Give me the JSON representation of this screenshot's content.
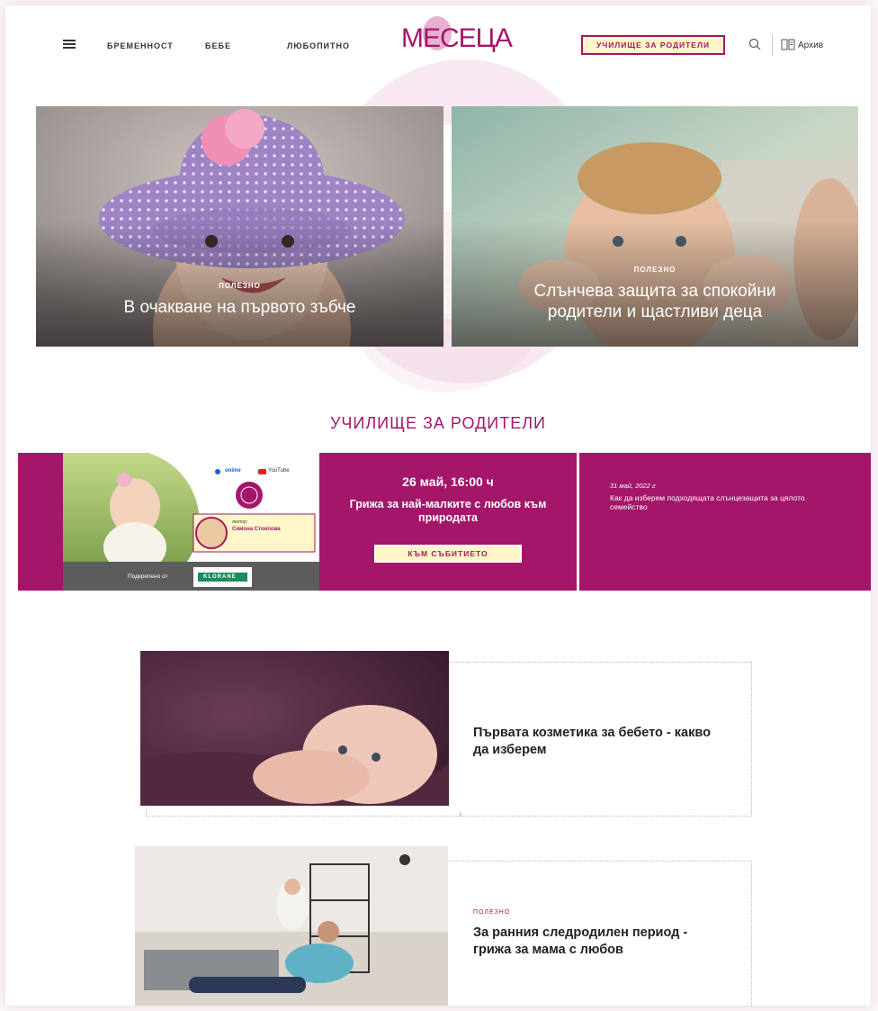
{
  "header": {
    "nav": [
      "БРЕМЕННОСТ",
      "БЕБЕ",
      "ЛЮБОПИТНО"
    ],
    "logo": "МЕСЕЦА",
    "school_button": "УЧИЛИЩЕ ЗА РОДИТЕЛИ",
    "archive": "Архив"
  },
  "hero": [
    {
      "tag": "ПОЛЕЗНО",
      "title": "В очакване на първото зъбче"
    },
    {
      "tag": "ПОЛЕЗНО",
      "title": "Слънчева защита за спокойни родители и щастливи деца"
    }
  ],
  "school": {
    "title": "УЧИЛИЩЕ ЗА РОДИТЕЛИ",
    "promo": {
      "social_1": "online",
      "social_2": "YouTube",
      "lecturer_label": "лектор:",
      "lecturer_name": "Симона Стоилова",
      "supported_by": "Подкрепено от",
      "sponsor": "KLORANE"
    },
    "event": {
      "date": "26 май, 16:00 ч",
      "title": "Грижа за най-малките с любов към природата",
      "button": "КЪМ СЪБИТИЕТО"
    },
    "next": {
      "date": "31 май, 2022 г",
      "title": "Как да изберем подходящата слънцезащита за цялото семейство"
    }
  },
  "articles": [
    {
      "tag": "",
      "title": "Първата козметика за бебето - какво да изберем"
    },
    {
      "tag": "ПОЛЕЗНО",
      "title": "За ранния следродилен период - грижа за мама с любов"
    }
  ],
  "colors": {
    "accent": "#a3166a",
    "button_bg": "#fff6c7"
  }
}
